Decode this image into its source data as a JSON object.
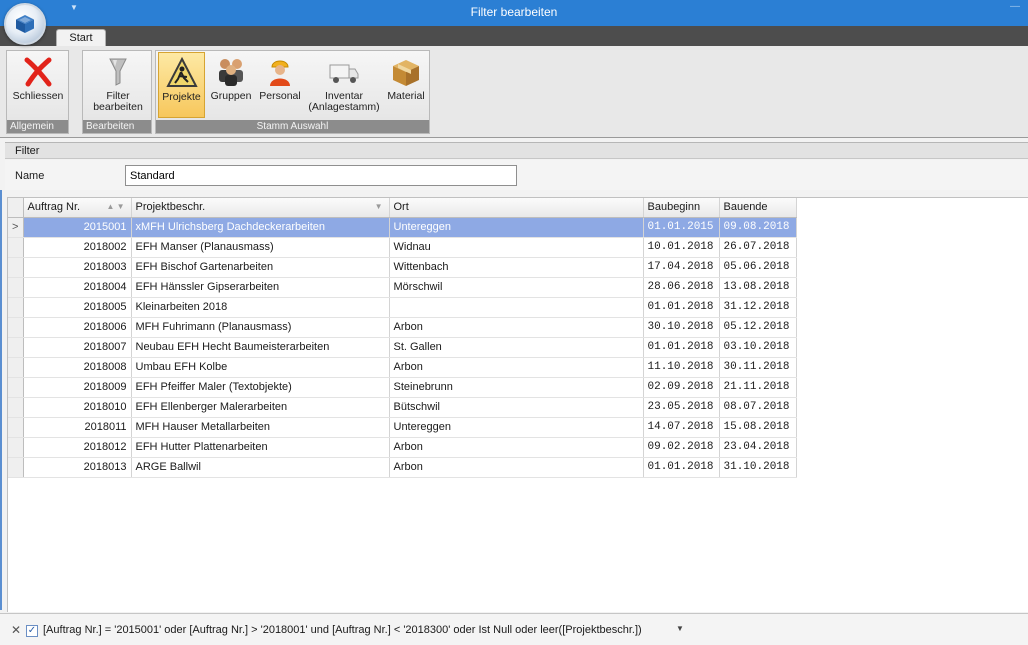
{
  "window": {
    "title": "Filter bearbeiten"
  },
  "tabs": [
    {
      "label": "Start"
    }
  ],
  "ribbon": {
    "groups": [
      {
        "label": "Allgemein",
        "buttons": [
          {
            "label": "Schliessen",
            "icon": "close-x-icon"
          }
        ]
      },
      {
        "label": "Bearbeiten",
        "buttons": [
          {
            "label": "Filter bearbeiten",
            "line1": "Filter",
            "line2": "bearbeiten",
            "icon": "filter-icon"
          }
        ]
      },
      {
        "label": "Stamm Auswahl",
        "buttons": [
          {
            "label": "Projekte",
            "icon": "construction-sign-icon",
            "active": true
          },
          {
            "label": "Gruppen",
            "icon": "group-icon"
          },
          {
            "label": "Personal",
            "icon": "worker-icon"
          },
          {
            "label": "Inventar (Anlagestamm)",
            "line1": "Inventar",
            "line2": "(Anlagestamm)",
            "icon": "truck-icon"
          },
          {
            "label": "Material",
            "icon": "box-icon"
          }
        ]
      }
    ]
  },
  "filter": {
    "header": "Filter",
    "name_label": "Name",
    "name_value": "Standard"
  },
  "grid": {
    "columns": [
      "Auftrag Nr.",
      "Projektbeschr.",
      "Ort",
      "Baubeginn",
      "Bauende"
    ],
    "rows": [
      [
        "2015001",
        "xMFH Ulrichsberg Dachdeckerarbeiten",
        "Untereggen",
        "01.01.2015",
        "09.08.2018"
      ],
      [
        "2018002",
        "EFH Manser (Planausmass)",
        "Widnau",
        "10.01.2018",
        "26.07.2018"
      ],
      [
        "2018003",
        "EFH Bischof Gartenarbeiten",
        "Wittenbach",
        "17.04.2018",
        "05.06.2018"
      ],
      [
        "2018004",
        "EFH Hänssler Gipserarbeiten",
        "Mörschwil",
        "28.06.2018",
        "13.08.2018"
      ],
      [
        "2018005",
        "Kleinarbeiten 2018",
        "",
        "01.01.2018",
        "31.12.2018"
      ],
      [
        "2018006",
        "MFH Fuhrimann (Planausmass)",
        "Arbon",
        "30.10.2018",
        "05.12.2018"
      ],
      [
        "2018007",
        "Neubau EFH Hecht Baumeisterarbeiten",
        "St. Gallen",
        "01.01.2018",
        "03.10.2018"
      ],
      [
        "2018008",
        "Umbau EFH Kolbe",
        "Arbon",
        "11.10.2018",
        "30.11.2018"
      ],
      [
        "2018009",
        "EFH Pfeiffer Maler (Textobjekte)",
        "Steinebrunn",
        "02.09.2018",
        "21.11.2018"
      ],
      [
        "2018010",
        "EFH Ellenberger Malerarbeiten",
        "Bütschwil",
        "23.05.2018",
        "08.07.2018"
      ],
      [
        "2018011",
        "MFH Hauser Metallarbeiten",
        "Untereggen",
        "14.07.2018",
        "15.08.2018"
      ],
      [
        "2018012",
        "EFH Hutter Plattenarbeiten",
        "Arbon",
        "09.02.2018",
        "23.04.2018"
      ],
      [
        "2018013",
        "ARGE Ballwil",
        "Arbon",
        "01.01.2018",
        "31.10.2018"
      ]
    ],
    "selected_row": 0
  },
  "status": {
    "filter_expression": "[Auftrag Nr.] = '2015001' oder [Auftrag Nr.] > '2018001' und [Auftrag Nr.] < '2018300' oder Ist Null oder leer([Projektbeschr.])",
    "enabled": true
  }
}
